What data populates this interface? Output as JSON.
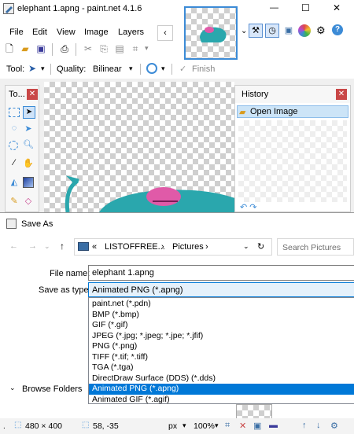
{
  "window": {
    "title": "elephant 1.apng - paint.net 4.1.6",
    "min": "—",
    "max": "☐",
    "close": "✕"
  },
  "menu": [
    "File",
    "Edit",
    "View",
    "Image",
    "Layers"
  ],
  "toolbar": {
    "tool_label": "Tool:",
    "quality_label": "Quality:",
    "quality_value": "Bilinear",
    "finish_label": "Finish"
  },
  "tools_panel": {
    "title": "To..."
  },
  "history_panel": {
    "title": "History",
    "item": "Open Image"
  },
  "dialog": {
    "title": "Save As",
    "path": [
      "«",
      "LISTOFFREE...",
      "›",
      "Pictures",
      "›"
    ],
    "search_placeholder": "Search Pictures",
    "filename_label": "File name:",
    "filename_value": "elephant 1.apng",
    "savetype_label": "Save as type:",
    "savetype_value": "Animated PNG (*.apng)",
    "browse_folders": "Browse Folders",
    "types": [
      "paint.net (*.pdn)",
      "BMP (*.bmp)",
      "GIF (*.gif)",
      "JPEG (*.jpg; *.jpeg; *.jpe; *.jfif)",
      "PNG (*.png)",
      "TIFF (*.tif; *.tiff)",
      "TGA (*.tga)",
      "DirectDraw Surface (DDS) (*.dds)",
      "Animated PNG (*.apng)",
      "Animated GIF (*.agif)"
    ],
    "selected_index": 8
  },
  "status": {
    "image_size": "480 × 400",
    "cursor_pos": "58, -35",
    "unit": "px",
    "zoom": "100%"
  },
  "colors": {
    "accent": "#0078d7",
    "teal": "#2aa7ad",
    "pink": "#e05aa8"
  }
}
